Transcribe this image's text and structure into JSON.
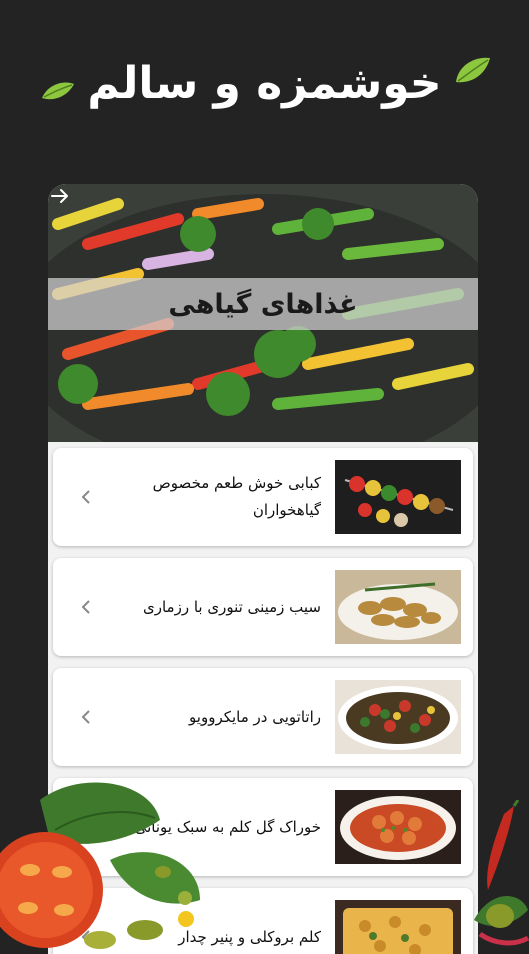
{
  "app": {
    "logo_text": "خوشمزه و سالم"
  },
  "category": {
    "title": "غذاهای گیاهی",
    "back_icon": "arrow-right-icon"
  },
  "recipes": [
    {
      "title": "کبابی خوش طعم مخصوص گیاهخواران",
      "chevron": "chevron-left-icon"
    },
    {
      "title": "سیب زمینی تنوری با رزماری",
      "chevron": "chevron-left-icon"
    },
    {
      "title": "راتاتویی در مایکروویو",
      "chevron": "chevron-left-icon"
    },
    {
      "title": "خوراک گل کلم به سبک یونانی",
      "chevron": "chevron-left-icon"
    },
    {
      "title": "کلم بروکلی و پنیر چدار",
      "chevron": "chevron-left-icon"
    }
  ],
  "colors": {
    "background": "#232323",
    "leaf_green": "#8dc63f",
    "card": "#ffffff",
    "banner": "#d2d2d2"
  }
}
